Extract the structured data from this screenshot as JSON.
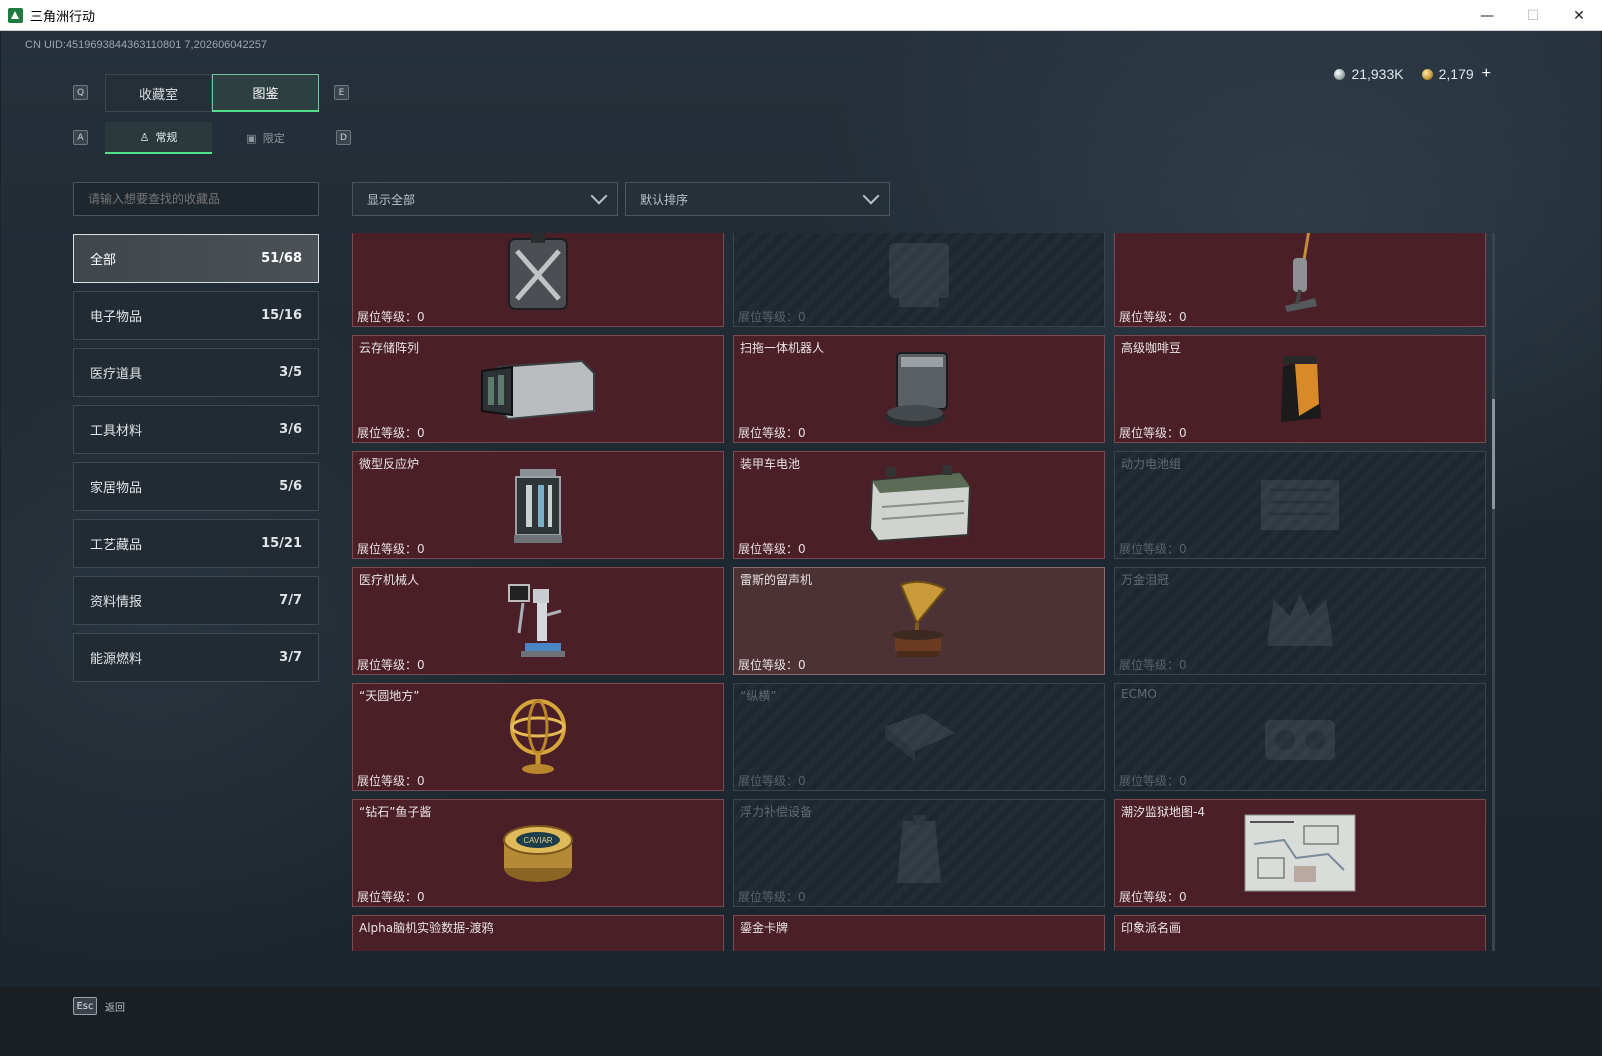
{
  "window": {
    "title": "三角洲行动",
    "min": "—",
    "max": "☐",
    "close": "✕"
  },
  "uid": "CN UID:4519693844363110801 7,202606042257",
  "currency": [
    {
      "icon": "silver-coin-icon",
      "value": "21,933K"
    },
    {
      "icon": "gold-coin-icon",
      "value": "2,179"
    }
  ],
  "currency_plus": "+",
  "keys": {
    "q": "Q",
    "e": "E",
    "a": "A",
    "d": "D",
    "esc": "Esc"
  },
  "main_tabs": [
    {
      "label": "收藏室",
      "active": false
    },
    {
      "label": "图鉴",
      "active": true
    }
  ],
  "sub_tabs": [
    {
      "label": "常规",
      "icon": "figure-icon",
      "active": true
    },
    {
      "label": "限定",
      "icon": "image-icon",
      "active": false
    }
  ],
  "search": {
    "placeholder": "请输入想要查找的收藏品"
  },
  "categories": [
    {
      "label": "全部",
      "count": "51/68",
      "active": true
    },
    {
      "label": "电子物品",
      "count": "15/16",
      "active": false
    },
    {
      "label": "医疗道具",
      "count": "3/5",
      "active": false
    },
    {
      "label": "工具材料",
      "count": "3/6",
      "active": false
    },
    {
      "label": "家居物品",
      "count": "5/6",
      "active": false
    },
    {
      "label": "工艺藏品",
      "count": "15/21",
      "active": false
    },
    {
      "label": "资料情报",
      "count": "7/7",
      "active": false
    },
    {
      "label": "能源燃料",
      "count": "3/7",
      "active": false
    }
  ],
  "filters": {
    "display": "显示全部",
    "sort": "默认排序"
  },
  "level_label": "展位等级：",
  "items": [
    {
      "name": "",
      "level": "0",
      "locked": false,
      "icon": "jerrycan-icon"
    },
    {
      "name": "",
      "level": "0",
      "locked": true,
      "icon": "device-icon"
    },
    {
      "name": "",
      "level": "0",
      "locked": false,
      "icon": "vacuum-icon"
    },
    {
      "name": "云存储阵列",
      "level": "0",
      "locked": false,
      "icon": "storage-array-icon"
    },
    {
      "name": "扫拖一体机器人",
      "level": "0",
      "locked": false,
      "icon": "robot-vacuum-icon"
    },
    {
      "name": "高级咖啡豆",
      "level": "0",
      "locked": false,
      "icon": "coffee-bag-icon"
    },
    {
      "name": "微型反应炉",
      "level": "0",
      "locked": false,
      "icon": "reactor-icon"
    },
    {
      "name": "装甲车电池",
      "level": "0",
      "locked": false,
      "icon": "battery-icon"
    },
    {
      "name": "动力电池组",
      "level": "0",
      "locked": true,
      "icon": "battery-pack-icon"
    },
    {
      "name": "医疗机械人",
      "level": "0",
      "locked": false,
      "icon": "medical-robot-icon"
    },
    {
      "name": "雷斯的留声机",
      "level": "0",
      "locked": false,
      "icon": "gramophone-icon",
      "highlight": true
    },
    {
      "name": "万金泪冠",
      "level": "0",
      "locked": true,
      "icon": "crown-icon"
    },
    {
      "name": "“天圆地方”",
      "level": "0",
      "locked": false,
      "icon": "armillary-icon"
    },
    {
      "name": "“纵横”",
      "level": "0",
      "locked": true,
      "icon": "board-icon"
    },
    {
      "name": "ECMO",
      "level": "0",
      "locked": true,
      "icon": "ecmo-icon"
    },
    {
      "name": "“钻石”鱼子酱",
      "level": "0",
      "locked": false,
      "icon": "caviar-icon"
    },
    {
      "name": "浮力补偿设备",
      "level": "0",
      "locked": true,
      "icon": "bcd-icon"
    },
    {
      "name": "潮汐监狱地图-4",
      "level": "0",
      "locked": false,
      "icon": "map-icon"
    },
    {
      "name": "Alpha脑机实验数据-渡鸦",
      "level": "",
      "locked": false,
      "icon": "data-drive-icon"
    },
    {
      "name": "鎏金卡牌",
      "level": "",
      "locked": false,
      "icon": "card-icon"
    },
    {
      "name": "印象派名画",
      "level": "",
      "locked": false,
      "icon": "painting-icon"
    }
  ],
  "caviar_label": "CAVIAR",
  "esc_label": "返回"
}
